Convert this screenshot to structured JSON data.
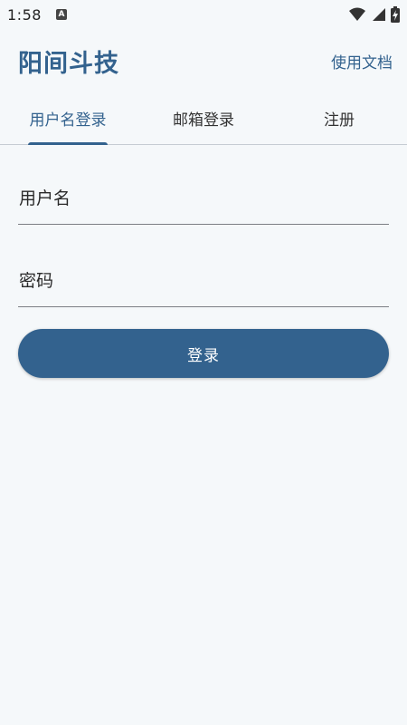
{
  "status_bar": {
    "time": "1:58",
    "notification_icon": "A"
  },
  "app_bar": {
    "title": "阳间斗技",
    "docs_link": "使用文档"
  },
  "tabs": [
    {
      "label": "用户名登录",
      "active": true
    },
    {
      "label": "邮箱登录",
      "active": false
    },
    {
      "label": "注册",
      "active": false
    }
  ],
  "form": {
    "username_label": "用户名",
    "password_label": "密码",
    "login_button": "登录"
  },
  "colors": {
    "primary": "#33628e",
    "background": "#f5f8fa"
  }
}
